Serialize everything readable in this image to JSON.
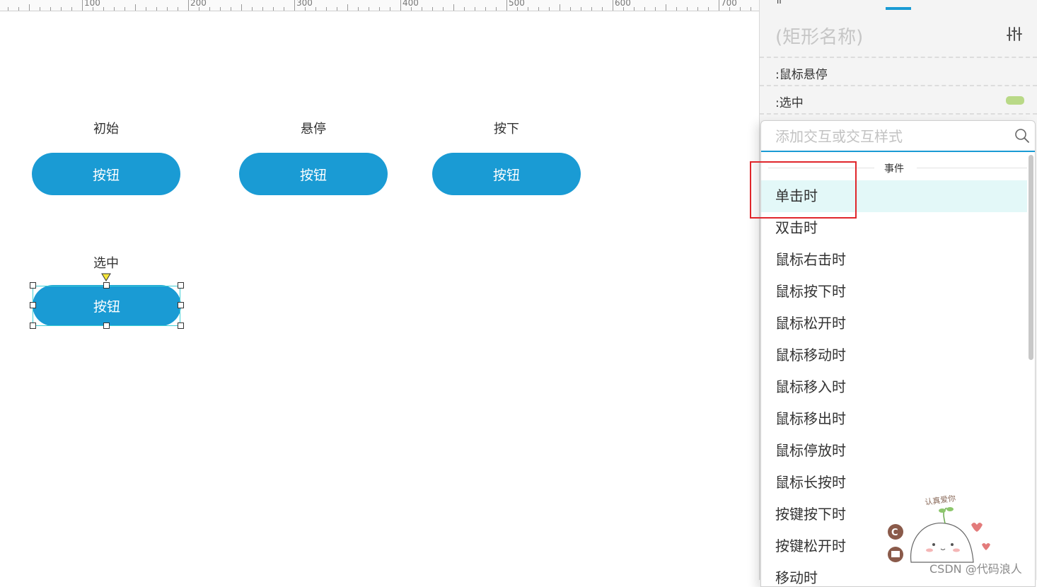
{
  "ruler": {
    "labels": [
      "100",
      "200",
      "300",
      "400",
      "500",
      "600",
      "700"
    ]
  },
  "canvas": {
    "states": [
      {
        "label": "初始",
        "button": "按钮"
      },
      {
        "label": "悬停",
        "button": "按钮"
      },
      {
        "label": "按下",
        "button": "按钮"
      }
    ],
    "selected_state": {
      "label": "选中",
      "button": "按钮"
    },
    "colors": {
      "button": "#1a9bd4",
      "selection": "#3ccfd6"
    }
  },
  "panel": {
    "shape_name": "(矩形名称)",
    "style_rows": [
      ":鼠标悬停",
      ":选中"
    ],
    "icons": {
      "settings": "sliders-icon"
    }
  },
  "dropdown": {
    "search_placeholder": "添加交互或交互样式",
    "section": "事件",
    "items": [
      "单击时",
      "双击时",
      "鼠标右击时",
      "鼠标按下时",
      "鼠标松开时",
      "鼠标移动时",
      "鼠标移入时",
      "鼠标移出时",
      "鼠标停放时",
      "鼠标长按时",
      "按键按下时",
      "按键松开时",
      "移动时"
    ],
    "highlighted": "单击时",
    "colors": {
      "highlight": "#e3f8f8",
      "annotation": "#e0262b"
    }
  },
  "watermark": {
    "text": "CSDN @代码浪人",
    "art_text": "认真爱你"
  }
}
